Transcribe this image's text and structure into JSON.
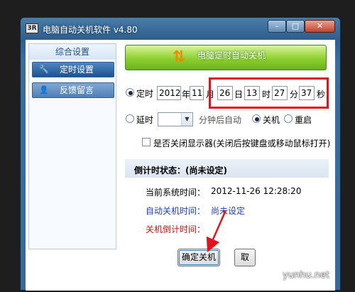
{
  "window": {
    "title": "电脑自动关机软件 v4.80",
    "app_icon": "3R",
    "controls": {
      "minimize": "–",
      "maximize": "□",
      "close": "✕"
    }
  },
  "sidebar": {
    "header": "综合设置",
    "items": [
      {
        "label": "定时设置",
        "icon": "tools-icon",
        "active": true
      },
      {
        "label": "反馈留言",
        "icon": "user-icon",
        "active": false
      }
    ]
  },
  "banner": {
    "title": "电脑定时自动关机"
  },
  "timer": {
    "scheduled_label": "定时",
    "year": "2012",
    "year_unit": "年",
    "month": "11",
    "month_unit": "月",
    "day": "26",
    "day_unit": "日",
    "hour": "13",
    "hour_unit": "时",
    "minute": "27",
    "minute_unit": "分",
    "second": "37",
    "second_unit": "秒"
  },
  "delay": {
    "label": "延时",
    "value": "",
    "suffix": "分钟后自动",
    "shutdown_label": "关机",
    "restart_label": "重启"
  },
  "monitor_option": {
    "label": "是否关闭显示器(关闭后按键盘或移动鼠标打开)"
  },
  "countdown": {
    "status_label": "倒计时状态：(尚未设定)",
    "current_time_label": "当前系统时间：",
    "current_time_value": "2012-11-26 12:28:20",
    "auto_shutdown_label": "自动关机时间：",
    "auto_shutdown_value": "尚未设定",
    "shutdown_countdown_label": "关机倒计时间："
  },
  "buttons": {
    "confirm": "确定关机",
    "cancel": "取"
  },
  "watermark": "yunhu.net",
  "colors": {
    "highlight_box": "#e0141c",
    "arrow": "#e0141c",
    "banner_green": "#8dcf2f",
    "link_blue": "#1a3fb5",
    "alert_red": "#d01010"
  }
}
